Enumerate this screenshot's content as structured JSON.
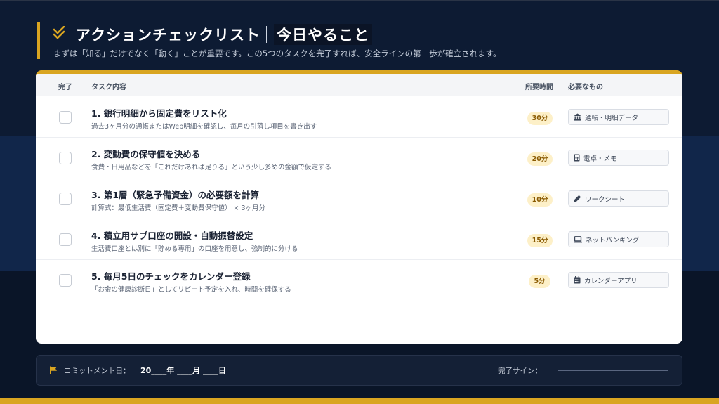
{
  "header": {
    "title": "アクションチェックリスト",
    "title_sub": "今日やること",
    "subtitle": "まずは「知る」だけでなく「動く」ことが重要です。この5つのタスクを完了すれば、安全ラインの第一歩が確立されます。",
    "icon": "double-check-icon"
  },
  "table": {
    "headers": {
      "done": "完了",
      "task": "タスク内容",
      "time": "所要時間",
      "needs": "必要なもの"
    },
    "rows": [
      {
        "title": "1. 銀行明細から固定費をリスト化",
        "desc": "過去3ヶ月分の通帳またはWeb明細を確認し、毎月の引落し項目を書き出す",
        "time": "30分",
        "need": "通帳・明細データ",
        "need_icon": "bank-icon"
      },
      {
        "title": "2. 変動費の保守値を決める",
        "desc": "食費・日用品などを「これだけあれば足りる」という少し多めの金額で仮定する",
        "time": "20分",
        "need": "電卓・メモ",
        "need_icon": "calculator-icon"
      },
      {
        "title": "3. 第1層（緊急予備資金）の必要額を計算",
        "desc": "計算式：最低生活費（固定費＋変動費保守値） × 3ヶ月分",
        "time": "10分",
        "need": "ワークシート",
        "need_icon": "pencil-icon"
      },
      {
        "title": "4. 積立用サブ口座の開設・自動振替設定",
        "desc": "生活費口座とは別に「貯める専用」の口座を用意し、強制的に分ける",
        "time": "15分",
        "need": "ネットバンキング",
        "need_icon": "laptop-icon"
      },
      {
        "title": "5. 毎月5日のチェックをカレンダー登録",
        "desc": "「お金の健康診断日」としてリピート予定を入れ、時間を確保する",
        "time": "5分",
        "need": "カレンダーアプリ",
        "need_icon": "calendar-icon"
      }
    ]
  },
  "footer": {
    "commit_label": "コミットメント日：",
    "commit_date": "20____年 ____月 ____日",
    "sign_label": "完了サイン：",
    "flag_icon": "flag-icon"
  },
  "colors": {
    "background": "#0d1b33",
    "accent": "#d9a521",
    "card": "#ffffff",
    "badge_bg": "#fdf0c8"
  }
}
